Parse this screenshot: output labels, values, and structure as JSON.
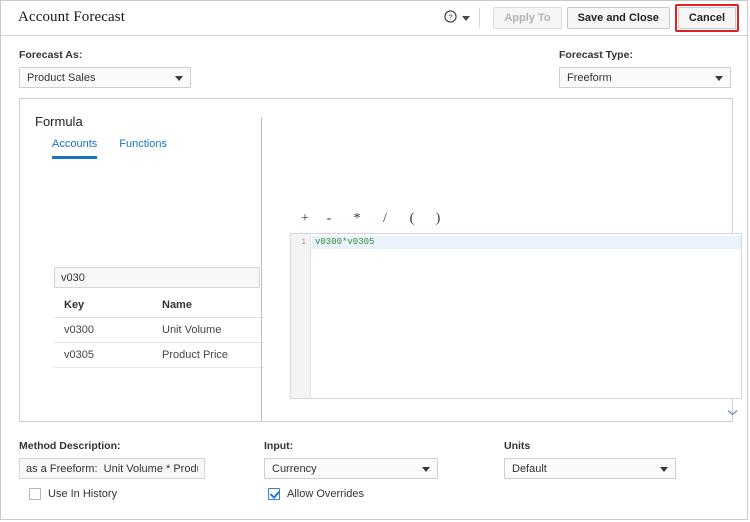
{
  "header": {
    "title": "Account Forecast",
    "help_icon": "help-circle-icon",
    "help_caret_icon": "chevron-down-icon",
    "apply_to_label": "Apply To",
    "save_and_close_label": "Save and Close",
    "cancel_label": "Cancel",
    "cancel_highlight_color": "#e02020"
  },
  "top_fields": {
    "forecast_as_label": "Forecast As:",
    "forecast_as_value": "Product Sales",
    "forecast_type_label": "Forecast Type:",
    "forecast_type_value": "Freeform"
  },
  "formula": {
    "heading": "Formula",
    "tabs": [
      {
        "label": "Accounts",
        "active": true
      },
      {
        "label": "Functions",
        "active": false
      }
    ],
    "search_value": "v030",
    "search_placeholder": "",
    "table": {
      "columns": [
        "Key",
        "Name"
      ],
      "rows": [
        {
          "key": "v0300",
          "name": "Unit Volume"
        },
        {
          "key": "v0305",
          "name": "Product Price"
        }
      ]
    },
    "operators": [
      "+",
      "-",
      "*",
      "/",
      "(",
      ")"
    ],
    "editor": {
      "line_number": "1",
      "code": "v0300*v0305",
      "code_color": "#2e8b3d",
      "active_line_color": "#eaf2fb"
    },
    "expand_icon": "chevron-down-icon"
  },
  "bottom_fields": {
    "method_description_label": "Method Description:",
    "method_description_value": "as a Freeform:  Unit Volume * Product",
    "input_label": "Input:",
    "input_value": "Currency",
    "units_label": "Units",
    "units_value": "Default",
    "use_in_history_label": "Use In History",
    "use_in_history_checked": false,
    "allow_overrides_label": "Allow Overrides",
    "allow_overrides_checked": true
  },
  "colors": {
    "accent_blue": "#1a73c4",
    "border": "#d0d0d0"
  }
}
